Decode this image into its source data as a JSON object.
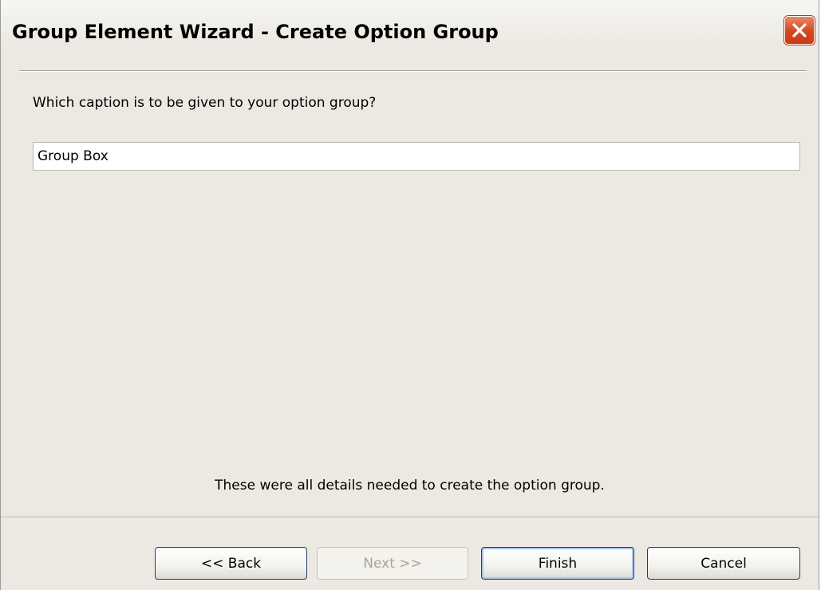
{
  "window": {
    "title": "Group Element Wizard - Create Option Group"
  },
  "content": {
    "prompt_label": "Which caption is to be given to your option group?",
    "caption_value": "Group Box",
    "status_message": "These were all details needed to create the option group."
  },
  "buttons": {
    "back_label": "<< Back",
    "next_label": "Next >>",
    "finish_label": "Finish",
    "cancel_label": "Cancel",
    "next_disabled": true
  },
  "icons": {
    "close": "close-icon"
  },
  "colors": {
    "window_bg": "#ece9e2",
    "close_button": "#d5461f",
    "button_border": "#1f3f73",
    "disabled_text": "#a7a59b"
  }
}
